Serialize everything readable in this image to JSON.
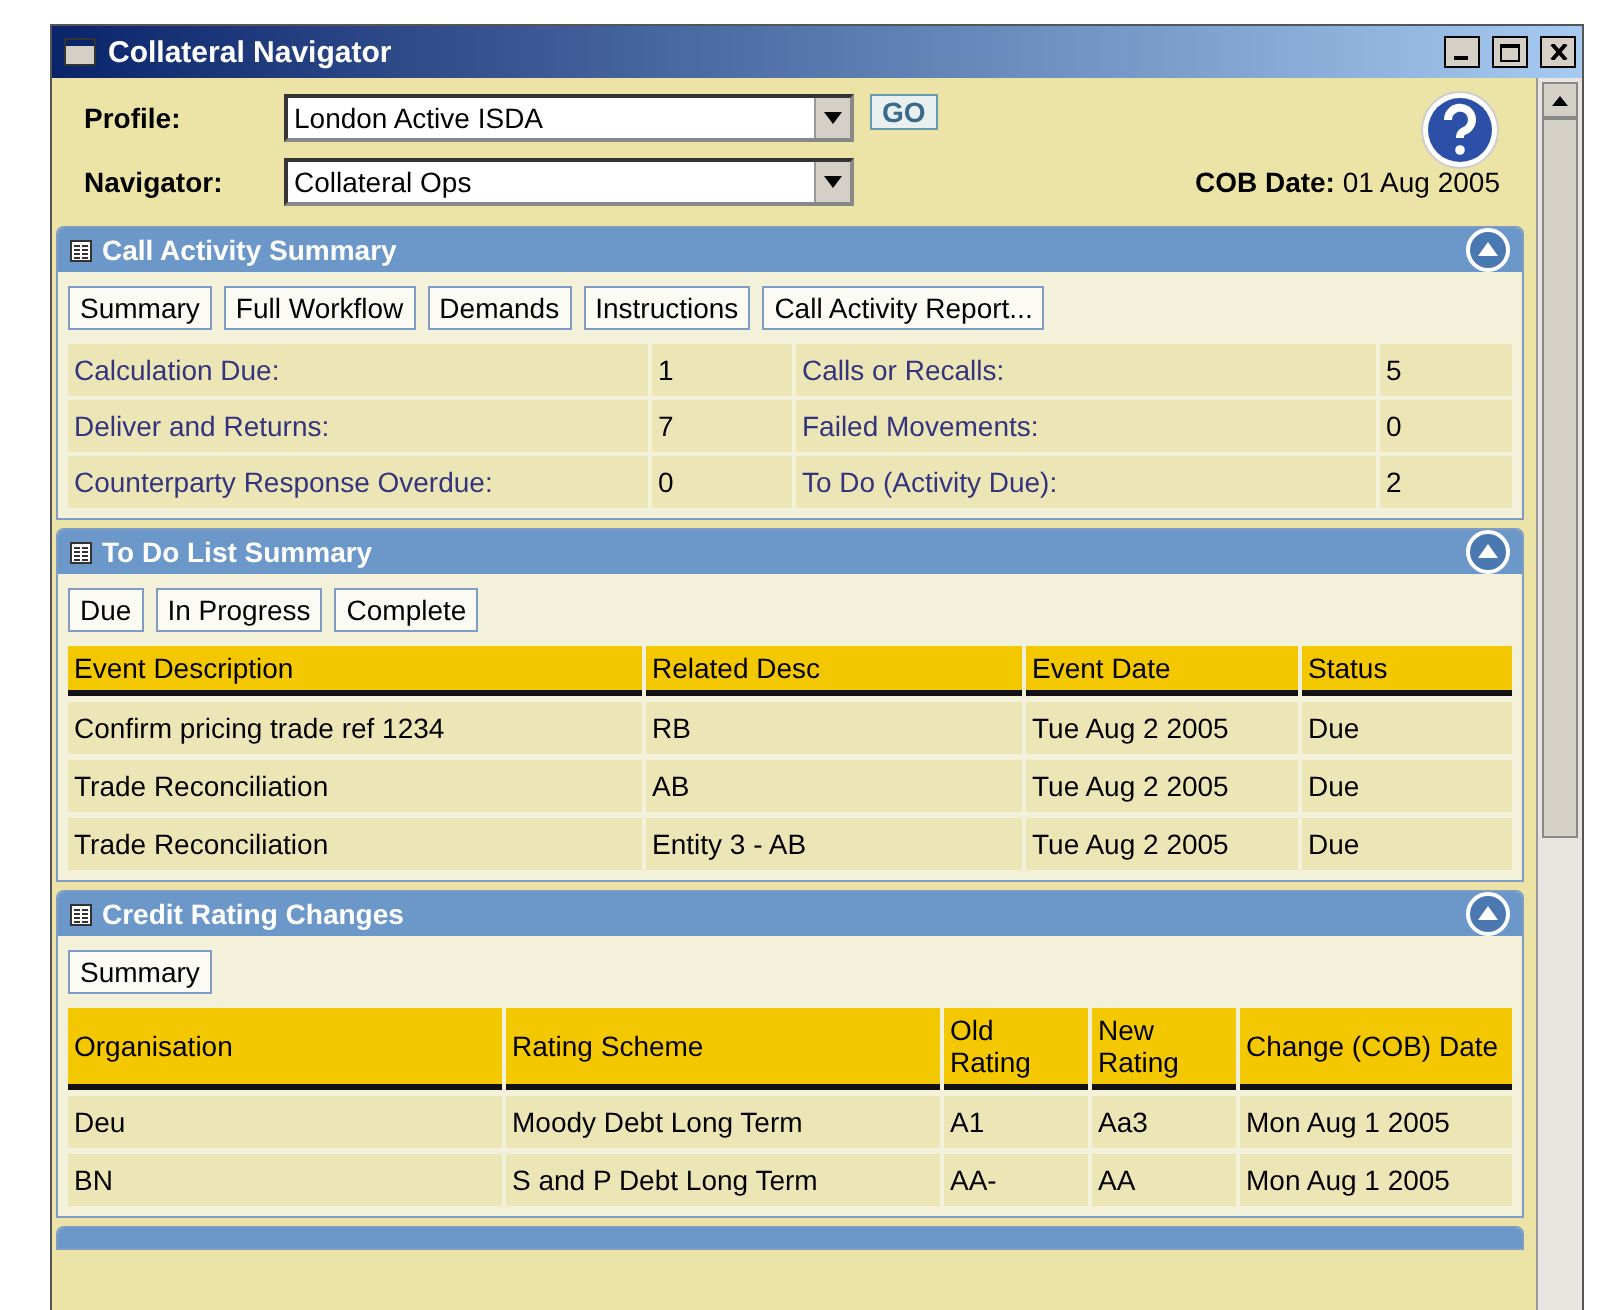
{
  "window": {
    "title": "Collateral Navigator"
  },
  "header": {
    "profile": {
      "label": "Profile:",
      "value": "London Active ISDA"
    },
    "go_button": "GO",
    "navigator": {
      "label": "Navigator:",
      "value": "Collateral Ops"
    },
    "cob_date": {
      "label": "COB Date:",
      "value": "01 Aug 2005"
    }
  },
  "panels": [
    {
      "kind": "stats",
      "title": "Call Activity Summary",
      "buttons": [
        "Summary",
        "Full Workflow",
        "Demands",
        "Instructions",
        "Call Activity Report..."
      ],
      "rows": [
        [
          {
            "label": "Calculation Due:",
            "value": "1"
          },
          {
            "label": "Calls or Recalls:",
            "value": "5"
          }
        ],
        [
          {
            "label": "Deliver and Returns:",
            "value": "7"
          },
          {
            "label": "Failed Movements:",
            "value": "0"
          }
        ],
        [
          {
            "label": "Counterparty Response Overdue:",
            "value": "0"
          },
          {
            "label": "To Do (Activity Due):",
            "value": "2"
          }
        ]
      ]
    },
    {
      "kind": "table",
      "title": "To Do List Summary",
      "buttons": [
        "Due",
        "In Progress",
        "Complete"
      ],
      "columns": [
        "Event Description",
        "Related Desc",
        "Event Date",
        "Status"
      ],
      "rows": [
        [
          "Confirm pricing trade ref 1234",
          "RB",
          "Tue Aug 2 2005",
          "Due"
        ],
        [
          "Trade Reconciliation",
          "AB",
          "Tue Aug 2 2005",
          "Due"
        ],
        [
          "Trade Reconciliation",
          "Entity 3 - AB",
          "Tue Aug 2 2005",
          "Due"
        ]
      ]
    },
    {
      "kind": "table",
      "title": "Credit Rating Changes",
      "buttons": [
        "Summary"
      ],
      "columns": [
        "Organisation",
        "Rating Scheme",
        "Old Rating",
        "New Rating",
        "Change (COB) Date"
      ],
      "rows": [
        [
          "Deu",
          "Moody Debt Long Term",
          "A1",
          "Aa3",
          "Mon Aug 1 2005"
        ],
        [
          "BN",
          "S and P Debt Long Term",
          "AA-",
          "AA",
          "Mon Aug 1 2005"
        ]
      ]
    },
    {
      "kind": "cut"
    }
  ]
}
